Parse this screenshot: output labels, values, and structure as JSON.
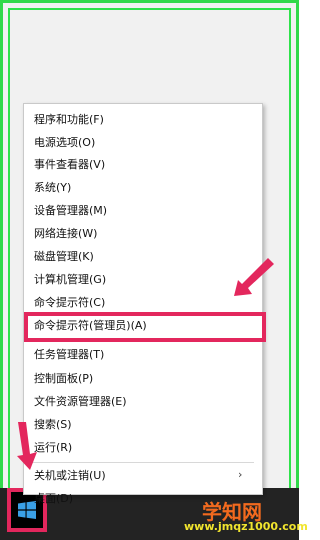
{
  "context_menu": {
    "items": [
      {
        "label": "程序和功能(F)"
      },
      {
        "label": "电源选项(O)"
      },
      {
        "label": "事件查看器(V)"
      },
      {
        "label": "系统(Y)"
      },
      {
        "label": "设备管理器(M)"
      },
      {
        "label": "网络连接(W)"
      },
      {
        "label": "磁盘管理(K)"
      },
      {
        "label": "计算机管理(G)"
      },
      {
        "label": "命令提示符(C)"
      },
      {
        "label": "命令提示符(管理员)(A)"
      },
      {
        "label": "任务管理器(T)"
      },
      {
        "label": "控制面板(P)"
      },
      {
        "label": "文件资源管理器(E)"
      },
      {
        "label": "搜索(S)"
      },
      {
        "label": "运行(R)"
      },
      {
        "label": "关机或注销(U)",
        "submenu_arrow": "›"
      },
      {
        "label": "桌面(D)"
      }
    ]
  },
  "watermark": {
    "title": "学知网",
    "url": "www.jmqz1000.com"
  },
  "colors": {
    "frame_border": "#31d94a",
    "highlight": "#e3275d",
    "taskbar": "#232323",
    "watermark_title": "#f36a1e",
    "watermark_url": "#f1e52e"
  },
  "icons": {
    "start": "windows-logo-icon"
  }
}
